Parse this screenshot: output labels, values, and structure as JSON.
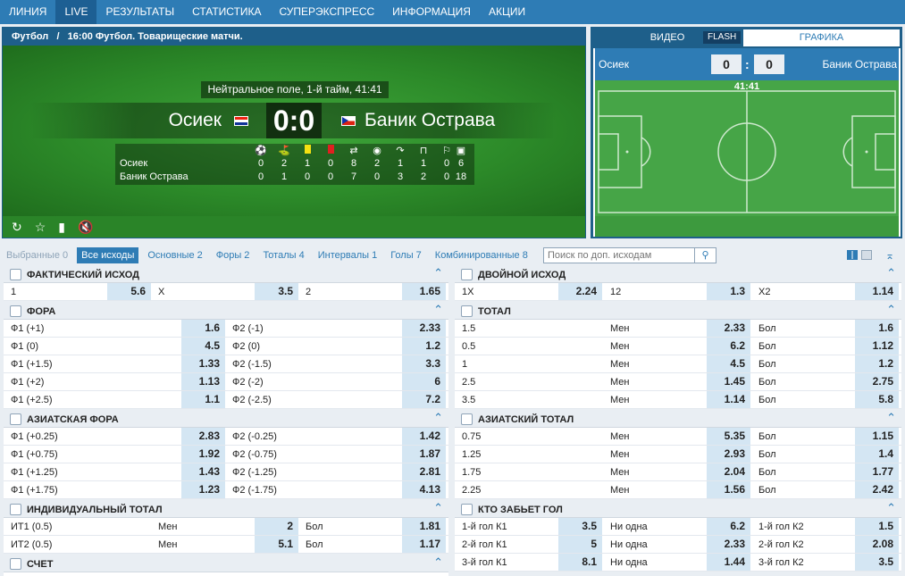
{
  "nav": {
    "items": [
      "ЛИНИЯ",
      "LIVE",
      "РЕЗУЛЬТАТЫ",
      "СТАТИСТИКА",
      "СУПЕРЭКСПРЕСС",
      "ИНФОРМАЦИЯ",
      "АКЦИИ"
    ],
    "active": "LIVE"
  },
  "match": {
    "breadcrumb_sport": "Футбол",
    "breadcrumb_sep": "/",
    "breadcrumb_event": "16:00 Футбол. Товарищеские матчи.",
    "status": "Нейтральное поле, 1-й тайм, 41:41",
    "team1": "Осиек",
    "team2": "Баник Острава",
    "score": "0:0",
    "stats_teams": [
      "Осиек",
      "Баник Острава"
    ],
    "stat_icons": [
      "ball-icon",
      "corner-flag-icon",
      "yellow-card-icon",
      "red-card-icon",
      "substitution-icon",
      "penalty-icon",
      "shots-icon",
      "goal-kick-icon",
      "offside-icon",
      "kit-icon"
    ],
    "stats_team1": [
      "0",
      "2",
      "1",
      "0",
      "8",
      "2",
      "1",
      "1",
      "0",
      "6"
    ],
    "stats_team2": [
      "0",
      "1",
      "0",
      "0",
      "7",
      "0",
      "3",
      "2",
      "0",
      "18"
    ]
  },
  "tracker": {
    "tabs": [
      "ВИДЕО",
      "FLASH",
      "ГРАФИКА"
    ],
    "active_tab": "ГРАФИКА",
    "team1": "Осиек",
    "team2": "Баник Острава",
    "score1": "0",
    "score2": "0",
    "colon": ":",
    "time": "41:41"
  },
  "filters": {
    "items": [
      "Выбранные 0",
      "Все исходы",
      "Основные 2",
      "Форы 2",
      "Тоталы 4",
      "Интервалы 1",
      "Голы 7",
      "Комбинированные 8"
    ],
    "active": "Все исходы",
    "search_placeholder": "Поиск по доп. исходам"
  },
  "markets": {
    "fact": {
      "title": "ФАКТИЧЕСКИЙ ИСХОД",
      "rows": [
        [
          "1",
          "5.6",
          "X",
          "3.5",
          "2",
          "1.65"
        ]
      ]
    },
    "double": {
      "title": "ДВОЙНОЙ ИСХОД",
      "rows": [
        [
          "1X",
          "2.24",
          "12",
          "1.3",
          "X2",
          "1.14"
        ]
      ]
    },
    "fora": {
      "title": "ФОРА",
      "rows": [
        [
          "Ф1 (+1)",
          "1.6",
          "Ф2 (-1)",
          "2.33"
        ],
        [
          "Ф1 (0)",
          "4.5",
          "Ф2 (0)",
          "1.2"
        ],
        [
          "Ф1 (+1.5)",
          "1.33",
          "Ф2 (-1.5)",
          "3.3"
        ],
        [
          "Ф1 (+2)",
          "1.13",
          "Ф2 (-2)",
          "6"
        ],
        [
          "Ф1 (+2.5)",
          "1.1",
          "Ф2 (-2.5)",
          "7.2"
        ]
      ]
    },
    "total": {
      "title": "ТОТАЛ",
      "rows": [
        [
          "1.5",
          "Мен",
          "2.33",
          "Бол",
          "1.6"
        ],
        [
          "0.5",
          "Мен",
          "6.2",
          "Бол",
          "1.12"
        ],
        [
          "1",
          "Мен",
          "4.5",
          "Бол",
          "1.2"
        ],
        [
          "2.5",
          "Мен",
          "1.45",
          "Бол",
          "2.75"
        ],
        [
          "3.5",
          "Мен",
          "1.14",
          "Бол",
          "5.8"
        ]
      ]
    },
    "asian_fora": {
      "title": "АЗИАТСКАЯ ФОРА",
      "rows": [
        [
          "Ф1 (+0.25)",
          "2.83",
          "Ф2 (-0.25)",
          "1.42"
        ],
        [
          "Ф1 (+0.75)",
          "1.92",
          "Ф2 (-0.75)",
          "1.87"
        ],
        [
          "Ф1 (+1.25)",
          "1.43",
          "Ф2 (-1.25)",
          "2.81"
        ],
        [
          "Ф1 (+1.75)",
          "1.23",
          "Ф2 (-1.75)",
          "4.13"
        ]
      ]
    },
    "asian_total": {
      "title": "АЗИАТСКИЙ ТОТАЛ",
      "rows": [
        [
          "0.75",
          "Мен",
          "5.35",
          "Бол",
          "1.15"
        ],
        [
          "1.25",
          "Мен",
          "2.93",
          "Бол",
          "1.4"
        ],
        [
          "1.75",
          "Мен",
          "2.04",
          "Бол",
          "1.77"
        ],
        [
          "2.25",
          "Мен",
          "1.56",
          "Бол",
          "2.42"
        ]
      ]
    },
    "ind_total": {
      "title": "ИНДИВИДУАЛЬНЫЙ ТОТАЛ",
      "rows": [
        [
          "ИТ1 (0.5)",
          "Мен",
          "2",
          "Бол",
          "1.81"
        ],
        [
          "ИТ2 (0.5)",
          "Мен",
          "5.1",
          "Бол",
          "1.17"
        ]
      ]
    },
    "who_scores": {
      "title": "КТО ЗАБЬЕТ ГОЛ",
      "rows": [
        [
          "1-й гол К1",
          "3.5",
          "Ни одна",
          "6.2",
          "1-й гол К2",
          "1.5"
        ],
        [
          "2-й гол К1",
          "5",
          "Ни одна",
          "2.33",
          "2-й гол К2",
          "2.08"
        ],
        [
          "3-й гол К1",
          "8.1",
          "Ни одна",
          "1.44",
          "3-й гол К2",
          "3.5"
        ]
      ]
    },
    "score": {
      "title": "СЧЕТ",
      "rows": []
    }
  },
  "colors": {
    "nav_bg": "#2e7cb5",
    "odds_bg": "#d4e6f3",
    "pitch": "#46a547"
  }
}
